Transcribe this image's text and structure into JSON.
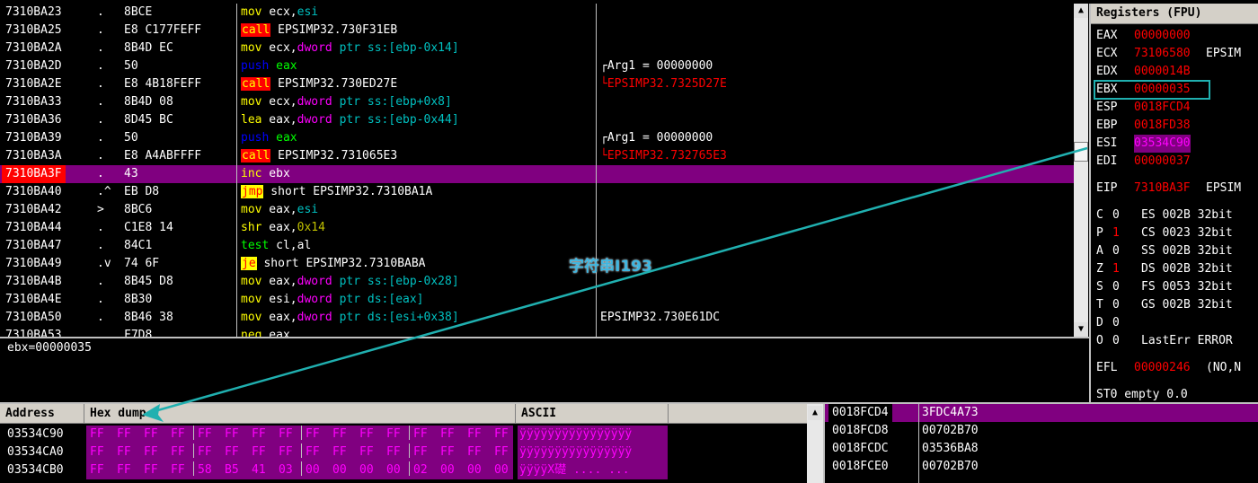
{
  "disasm": {
    "rows": [
      {
        "addr": "7310BA23",
        "mark": ".",
        "hex": "8BCE",
        "asm": [
          [
            "y",
            "mov"
          ],
          [
            "w",
            " "
          ],
          [
            "w",
            "ecx"
          ],
          [
            "w",
            ","
          ],
          [
            "c",
            "esi"
          ]
        ],
        "com": []
      },
      {
        "addr": "7310BA25",
        "mark": ".",
        "hex": "E8 C177FEFF",
        "asm": [
          [
            "call",
            "call"
          ],
          [
            "w",
            " EPSIMP32.730F31EB"
          ]
        ],
        "com": []
      },
      {
        "addr": "7310BA2A",
        "mark": ".",
        "hex": "8B4D EC",
        "asm": [
          [
            "y",
            "mov"
          ],
          [
            "w",
            " ecx,"
          ],
          [
            "m",
            "dword"
          ],
          [
            "c",
            " ptr ss:[ebp-0x14]"
          ]
        ],
        "com": []
      },
      {
        "addr": "7310BA2D",
        "mark": ".",
        "hex": "50",
        "asm": [
          [
            "b",
            "push"
          ],
          [
            "w",
            " "
          ],
          [
            "g",
            "eax"
          ]
        ],
        "com": [
          [
            "w",
            "┌Arg1 = 00000000"
          ]
        ]
      },
      {
        "addr": "7310BA2E",
        "mark": ".",
        "hex": "E8 4B18FEFF",
        "asm": [
          [
            "call",
            "call"
          ],
          [
            "w",
            " EPSIMP32.730ED27E"
          ]
        ],
        "com": [
          [
            "r",
            "└EPSIMP32.7325D27E"
          ]
        ]
      },
      {
        "addr": "7310BA33",
        "mark": ".",
        "hex": "8B4D 08",
        "asm": [
          [
            "y",
            "mov"
          ],
          [
            "w",
            " ecx,"
          ],
          [
            "m",
            "dword"
          ],
          [
            "c",
            " ptr ss:[ebp+0x8]"
          ]
        ],
        "com": []
      },
      {
        "addr": "7310BA36",
        "mark": ".",
        "hex": "8D45 BC",
        "asm": [
          [
            "y",
            "lea"
          ],
          [
            "w",
            " eax,"
          ],
          [
            "m",
            "dword"
          ],
          [
            "c",
            " ptr ss:[ebp-0x44]"
          ]
        ],
        "com": []
      },
      {
        "addr": "7310BA39",
        "mark": ".",
        "hex": "50",
        "asm": [
          [
            "b",
            "push"
          ],
          [
            "w",
            " "
          ],
          [
            "g",
            "eax"
          ]
        ],
        "com": [
          [
            "w",
            "┌Arg1 = 00000000"
          ]
        ]
      },
      {
        "addr": "7310BA3A",
        "mark": ".",
        "hex": "E8 A4ABFFFF",
        "asm": [
          [
            "call",
            "call"
          ],
          [
            "w",
            " EPSIMP32.731065E3"
          ]
        ],
        "com": [
          [
            "r",
            "└EPSIMP32.732765E3"
          ]
        ]
      },
      {
        "addr": "7310BA3F",
        "mark": ".",
        "hex": "43",
        "asm": [
          [
            "y",
            "inc"
          ],
          [
            "w",
            " ebx"
          ]
        ],
        "com": [],
        "highlight": true
      },
      {
        "addr": "7310BA40",
        "mark": ".^",
        "hex": "EB D8",
        "asm": [
          [
            "jmp",
            "jmp"
          ],
          [
            "w",
            " short EPSIMP32.7310BA1A"
          ]
        ],
        "com": []
      },
      {
        "addr": "7310BA42",
        "mark": ">",
        "hex": "8BC6",
        "asm": [
          [
            "y",
            "mov"
          ],
          [
            "w",
            " eax,"
          ],
          [
            "c",
            "esi"
          ]
        ],
        "com": []
      },
      {
        "addr": "7310BA44",
        "mark": ".",
        "hex": "C1E8 14",
        "asm": [
          [
            "y",
            "shr"
          ],
          [
            "w",
            " eax,"
          ],
          [
            "o",
            "0x14"
          ]
        ],
        "com": []
      },
      {
        "addr": "7310BA47",
        "mark": ".",
        "hex": "84C1",
        "asm": [
          [
            "g",
            "test"
          ],
          [
            "w",
            " cl,al"
          ]
        ],
        "com": []
      },
      {
        "addr": "7310BA49",
        "mark": ".v",
        "hex": "74 6F",
        "asm": [
          [
            "jmp",
            "je"
          ],
          [
            "w",
            " short EPSIMP32.7310BABA"
          ]
        ],
        "com": []
      },
      {
        "addr": "7310BA4B",
        "mark": ".",
        "hex": "8B45 D8",
        "asm": [
          [
            "y",
            "mov"
          ],
          [
            "w",
            " eax,"
          ],
          [
            "m",
            "dword"
          ],
          [
            "c",
            " ptr ss:[ebp-0x28]"
          ]
        ],
        "com": []
      },
      {
        "addr": "7310BA4E",
        "mark": ".",
        "hex": "8B30",
        "asm": [
          [
            "y",
            "mov"
          ],
          [
            "w",
            " esi,"
          ],
          [
            "m",
            "dword"
          ],
          [
            "c",
            " ptr ds:[eax]"
          ]
        ],
        "com": []
      },
      {
        "addr": "7310BA50",
        "mark": ".",
        "hex": "8B46 38",
        "asm": [
          [
            "y",
            "mov"
          ],
          [
            "w",
            " eax,"
          ],
          [
            "m",
            "dword"
          ],
          [
            "c",
            " ptr ds:[esi+0x38]"
          ]
        ],
        "com": [
          [
            "w",
            "EPSIMP32.730E61DC"
          ]
        ]
      },
      {
        "addr": "7310BA53",
        "mark": ".",
        "hex": "F7D8",
        "asm": [
          [
            "y",
            "neg"
          ],
          [
            "w",
            " eax"
          ]
        ],
        "com": []
      }
    ]
  },
  "info": {
    "text": "ebx=00000035"
  },
  "registers": {
    "title": "Registers (FPU)",
    "general": [
      {
        "name": "EAX",
        "value": "00000000",
        "extra": ""
      },
      {
        "name": "ECX",
        "value": "73106580",
        "extra": "EPSIM"
      },
      {
        "name": "EDX",
        "value": "0000014B",
        "extra": ""
      },
      {
        "name": "EBX",
        "value": "00000035",
        "extra": ""
      },
      {
        "name": "ESP",
        "value": "0018FCD4",
        "extra": ""
      },
      {
        "name": "EBP",
        "value": "0018FD38",
        "extra": ""
      },
      {
        "name": "ESI",
        "value": "03534C90",
        "extra": ""
      },
      {
        "name": "EDI",
        "value": "00000037",
        "extra": ""
      }
    ],
    "eip": {
      "name": "EIP",
      "value": "7310BA3F",
      "extra": "EPSIM"
    },
    "flags": [
      {
        "name": "C",
        "value": "0",
        "red": false,
        "seg": "ES 002B 32bit"
      },
      {
        "name": "P",
        "value": "1",
        "red": true,
        "seg": "CS 0023 32bit"
      },
      {
        "name": "A",
        "value": "0",
        "red": false,
        "seg": "SS 002B 32bit"
      },
      {
        "name": "Z",
        "value": "1",
        "red": true,
        "seg": "DS 002B 32bit"
      },
      {
        "name": "S",
        "value": "0",
        "red": false,
        "seg": "FS 0053 32bit"
      },
      {
        "name": "T",
        "value": "0",
        "red": false,
        "seg": "GS 002B 32bit"
      },
      {
        "name": "D",
        "value": "0",
        "red": false,
        "seg": ""
      },
      {
        "name": "O",
        "value": "0",
        "red": false,
        "seg": "LastErr ERROR"
      }
    ],
    "efl": {
      "name": "EFL",
      "value": "00000246",
      "extra": "(NO,N"
    },
    "st0": "ST0 empty 0.0"
  },
  "dump": {
    "headers": {
      "address": "Address",
      "hex": "Hex dump",
      "ascii": "ASCII"
    },
    "rows": [
      {
        "addr": "03534C90",
        "bytes": [
          "FF",
          "FF",
          "FF",
          "FF",
          "FF",
          "FF",
          "FF",
          "FF",
          "FF",
          "FF",
          "FF",
          "FF",
          "FF",
          "FF",
          "FF",
          "FF"
        ],
        "ascii": "ÿÿÿÿÿÿÿÿÿÿÿÿÿÿÿÿ"
      },
      {
        "addr": "03534CA0",
        "bytes": [
          "FF",
          "FF",
          "FF",
          "FF",
          "FF",
          "FF",
          "FF",
          "FF",
          "FF",
          "FF",
          "FF",
          "FF",
          "FF",
          "FF",
          "FF",
          "FF"
        ],
        "ascii": "ÿÿÿÿÿÿÿÿÿÿÿÿÿÿÿÿ"
      },
      {
        "addr": "03534CB0",
        "bytes": [
          "FF",
          "FF",
          "FF",
          "FF",
          "58",
          "B5",
          "41",
          "03",
          "00",
          "00",
          "00",
          "00",
          "02",
          "00",
          "00",
          "00"
        ],
        "ascii": "ÿÿÿÿX礎 .... ..."
      }
    ]
  },
  "stack": {
    "rows": [
      {
        "addr": "0018FCD4",
        "value": "3FDC4A73"
      },
      {
        "addr": "0018FCD8",
        "value": "00702B70"
      },
      {
        "addr": "0018FCDC",
        "value": "03536BA8"
      },
      {
        "addr": "0018FCE0",
        "value": "00702B70"
      }
    ]
  },
  "watermark": "字符串I193",
  "colors": {
    "highlight": "#800080",
    "accent": "#20b0b0"
  }
}
